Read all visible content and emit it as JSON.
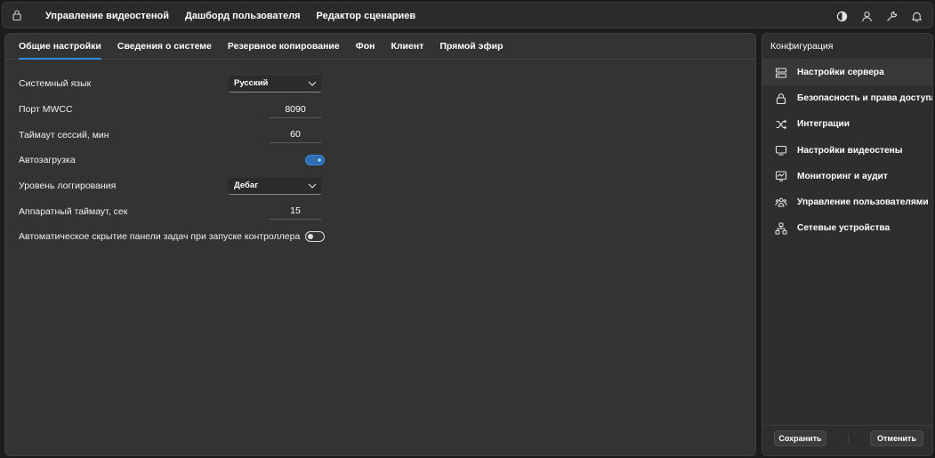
{
  "topbar": {
    "lock_icon": "lock-icon",
    "nav": [
      {
        "label": "Управление видеостеной"
      },
      {
        "label": "Дашборд пользователя"
      },
      {
        "label": "Редактор сценариев"
      }
    ],
    "icons": [
      "contrast-icon",
      "user-icon",
      "wrench-icon",
      "bell-icon"
    ]
  },
  "tabs": [
    {
      "label": "Общие настройки",
      "active": true
    },
    {
      "label": "Сведения о системе"
    },
    {
      "label": "Резервное копирование"
    },
    {
      "label": "Фон"
    },
    {
      "label": "Клиент"
    },
    {
      "label": "Прямой эфир"
    }
  ],
  "settings": {
    "language": {
      "label": "Системный язык",
      "value": "Русский"
    },
    "port": {
      "label": "Порт MWCC",
      "value": "8090"
    },
    "session_timeout": {
      "label": "Таймаут сессий, мин",
      "value": "60"
    },
    "autoload": {
      "label": "Автозагрузка",
      "enabled": true
    },
    "log_level": {
      "label": "Уровень логгирования",
      "value": "Дебаг"
    },
    "hw_timeout": {
      "label": "Аппаратный таймаут, сек",
      "value": "15"
    },
    "autohide_taskbar": {
      "label": "Автоматическое скрытие панели задач при запуске контроллера",
      "enabled": false
    }
  },
  "sidebar": {
    "title": "Конфигурация",
    "items": [
      {
        "label": "Настройки сервера",
        "icon": "server-icon",
        "active": true
      },
      {
        "label": "Безопасность и права доступа",
        "icon": "lock-icon"
      },
      {
        "label": "Интеграции",
        "icon": "shuffle-icon"
      },
      {
        "label": "Настройки видеостены",
        "icon": "monitor-icon"
      },
      {
        "label": "Мониторинг и аудит",
        "icon": "chart-monitor-icon"
      },
      {
        "label": "Управление пользователями",
        "icon": "users-icon"
      },
      {
        "label": "Сетевые устройства",
        "icon": "network-icon"
      }
    ],
    "save_label": "Сохранить",
    "cancel_label": "Отменить"
  },
  "colors": {
    "accent": "#2f8ee6",
    "panel": "#333333",
    "background": "#1c1c1c"
  }
}
